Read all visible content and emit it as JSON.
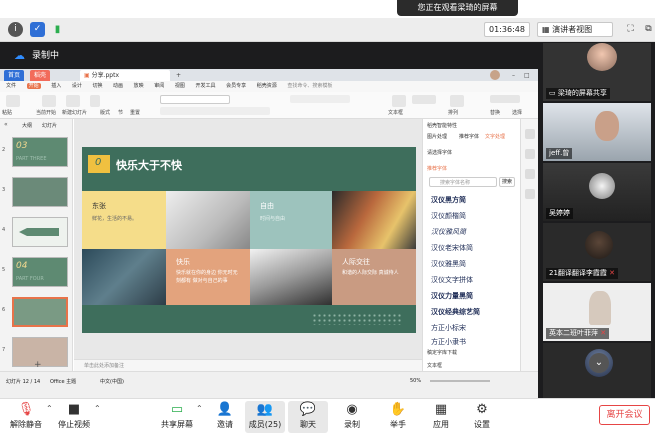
{
  "banner": {
    "text": "您正在观看梁琦的屏幕"
  },
  "topbar": {
    "timer": "01:36:48",
    "view_label": "演讲者视图"
  },
  "recording": {
    "label": "录制中"
  },
  "wps": {
    "tabs": [
      {
        "label": "首页"
      },
      {
        "label": "稻壳"
      },
      {
        "label": "分享.pptx"
      }
    ],
    "menu": [
      "文件",
      "开始",
      "插入",
      "设计",
      "切换",
      "动画",
      "放映",
      "审阅",
      "视图",
      "开发工具",
      "会员专享",
      "稻壳资源",
      "查找命令、搜索模板"
    ],
    "ribbon_labels": [
      "粘贴",
      "当前开始",
      "新建幻灯片",
      "版式",
      "节",
      "重置",
      "文本框",
      "排列",
      "替换",
      "选择"
    ],
    "thumb_tabs": [
      "大纲",
      "幻灯片"
    ],
    "thumbs": [
      {
        "num": "2",
        "text": "03",
        "sub": "PART THREE"
      },
      {
        "num": "3",
        "text": "",
        "sub": ""
      },
      {
        "num": "4",
        "text": "",
        "sub": ""
      },
      {
        "num": "5",
        "text": "04",
        "sub": "PART FOUR"
      },
      {
        "num": "6",
        "text": "",
        "sub": ""
      },
      {
        "num": "7",
        "text": "",
        "sub": ""
      }
    ],
    "slide": {
      "number": "0",
      "title": "快乐大于不快",
      "cells": [
        {
          "title": "东张",
          "body": "鲜花，生活的不易。"
        },
        {
          "title": "自由",
          "body": "时间与自由"
        },
        {
          "title": "快乐",
          "body": "快乐就在你的身边 你无时无刻都有 做对与自己的事"
        },
        {
          "title": "人际交往",
          "body": "和谐的人际交际 真诚待人"
        }
      ]
    },
    "notes_placeholder": "单击此处添加备注",
    "pane": {
      "tabs": [
        "稻壳智能特性",
        "图片处理",
        "推荐字体",
        "文字处理"
      ],
      "section1": "请选择字体",
      "section2": "推荐字体",
      "search_placeholder": "搜索字体名称",
      "search_btn": "搜索",
      "fonts": [
        "汉仪黑方简",
        "汉仪颜楷简",
        "汉仪雅风简",
        "汉仪老宋体简",
        "汉仪雅黑简",
        "汉仪文字拼体",
        "汉仪力量黑简",
        "汉仪经典综艺简",
        "方正小标宋",
        "方正小隶书"
      ],
      "more": "稿定字库下载",
      "footer": "文本框"
    },
    "status": {
      "slide_info": "幻灯片 12 / 14",
      "theme": "Office 主题",
      "lang": "中文(中国)",
      "zoom": "50%"
    }
  },
  "participants": [
    {
      "name": "梁琦的屏幕共享",
      "sharing": true
    },
    {
      "name": "jeff.曾",
      "sharing": false
    },
    {
      "name": "吴婷婷",
      "sharing": false
    },
    {
      "name": "21翻译翻译李霞霞",
      "sharing": false
    },
    {
      "name": "英本二班叶菲萍",
      "sharing": false
    },
    {
      "name": "",
      "sharing": false
    }
  ],
  "toolbar": {
    "mute": "解除静音",
    "video": "停止视频",
    "share": "共享屏幕",
    "invite": "邀请",
    "members": "成员(25)",
    "chat": "聊天",
    "record": "录制",
    "raise": "举手",
    "apps": "应用",
    "settings": "设置",
    "leave": "离开会议"
  },
  "colors": {
    "slide_green": "#3e6e5c",
    "accent_orange": "#e8734a",
    "leave_red": "#e64545",
    "recording_blue": "#2f8cff"
  }
}
